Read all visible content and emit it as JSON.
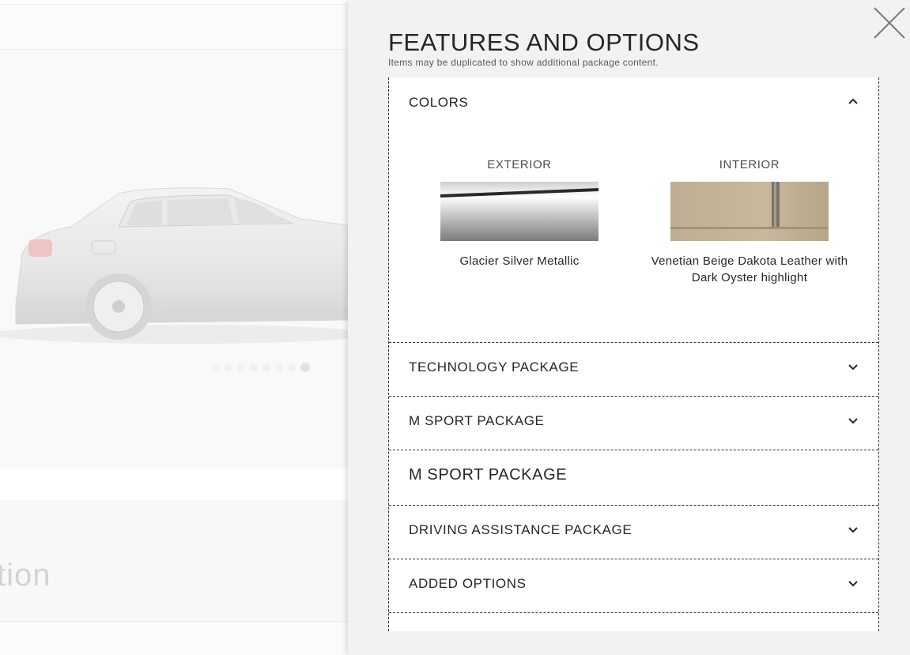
{
  "background": {
    "partial_heading": "tion"
  },
  "panel": {
    "title": "FEATURES AND OPTIONS",
    "subtitle": "Items may be duplicated to show additional package content.",
    "close_icon": "close-icon"
  },
  "colors": {
    "header": "COLORS",
    "exterior": {
      "label": "EXTERIOR",
      "name": "Glacier Silver Metallic"
    },
    "interior": {
      "label": "INTERIOR",
      "name": "Venetian Beige Dakota Leather with Dark Oyster highlight"
    }
  },
  "sections": [
    {
      "label": "TECHNOLOGY PACKAGE",
      "icon": "chevron-down-icon"
    },
    {
      "label": "M SPORT PACKAGE",
      "icon": "chevron-down-icon"
    },
    {
      "label": "M SPORT PACKAGE"
    },
    {
      "label": "DRIVING ASSISTANCE PACKAGE",
      "icon": "chevron-down-icon"
    },
    {
      "label": "ADDED OPTIONS",
      "icon": "chevron-down-icon"
    }
  ],
  "carousel": {
    "count": 8,
    "active_index": 7
  },
  "theme": {
    "panel_bg": "#f2f2f2",
    "text": "#262626"
  }
}
